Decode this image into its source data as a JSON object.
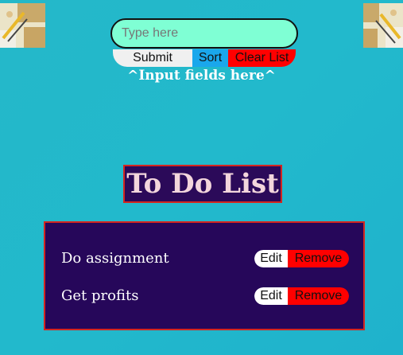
{
  "input": {
    "placeholder": "Type here",
    "value": ""
  },
  "buttons": {
    "submit_label": "Submit",
    "sort_label": "Sort",
    "clear_label": "Clear List"
  },
  "hint_text": "^Input fields here^",
  "title": "To Do List",
  "todo_items": [
    {
      "text": "Do assignment",
      "edit_label": "Edit",
      "remove_label": "Remove"
    },
    {
      "text": "Get profits",
      "edit_label": "Edit",
      "remove_label": "Remove"
    }
  ],
  "colors": {
    "background": "#22b9cc",
    "input_bg": "#7fffd4",
    "sort_button": "#1aa7ec",
    "clear_button": "#ff0000",
    "remove_button": "#ff0000",
    "panel_bg": "#26075a",
    "panel_border": "#d3261f",
    "title_text": "#f3d6dc"
  },
  "icons": {
    "corner_left": "desk-tools-image",
    "corner_right": "desk-tools-image"
  }
}
